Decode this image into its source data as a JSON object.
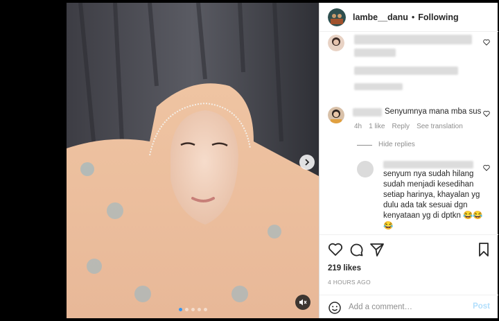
{
  "post": {
    "username": "lambe__danu",
    "separator": "•",
    "follow_status": "Following"
  },
  "comments": [
    {
      "text": "Senyumnya mana mba sus",
      "time": "4h",
      "likes": "1 like",
      "reply": "Reply",
      "translate": "See translation",
      "hide_replies": "Hide replies"
    }
  ],
  "reply": {
    "lines": [
      "senyum nya sudah hilang",
      "sudah menjadi kesedihan",
      "setiap harinya, khayalan yg",
      "dulu ada tak sesuai dgn",
      "kenyataan yg di dptkn 😂😂",
      "😂"
    ]
  },
  "stats": {
    "likes": "219 likes",
    "posted": "4 HOURS AGO"
  },
  "composer": {
    "placeholder": "Add a comment…",
    "post_label": "Post"
  },
  "carousel": {
    "slide_count": 5,
    "active_index": 0
  },
  "icons": {
    "like": "heart-icon",
    "comment": "comment-icon",
    "share": "share-icon",
    "save": "bookmark-icon",
    "emoji": "emoji-icon",
    "next": "chevron-right-icon",
    "mute": "speaker-muted-icon"
  },
  "colors": {
    "link_blue": "#3897f0",
    "post_disabled": "#b2dffc",
    "secondary_text": "#8e8e8e",
    "primary_text": "#262626"
  }
}
